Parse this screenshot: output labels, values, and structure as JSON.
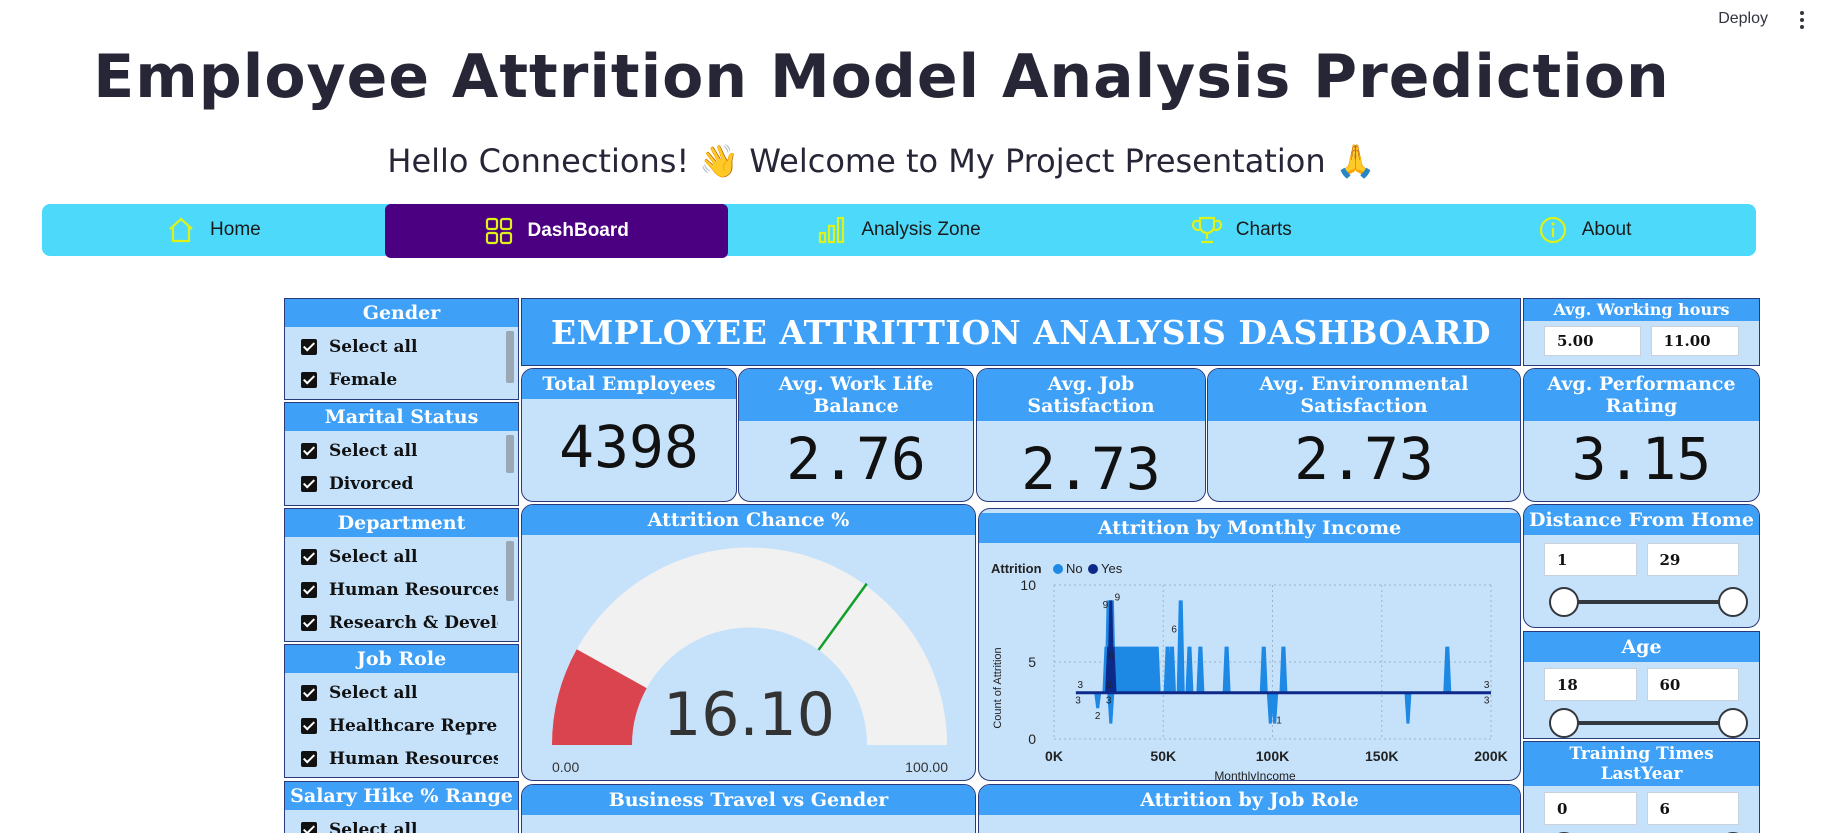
{
  "header": {
    "deploy_label": "Deploy"
  },
  "title": "Employee Attrition Model Analysis Prediction",
  "subtitle": "Hello Connections! 👋 Welcome to My Project Presentation 🙏",
  "nav": [
    {
      "label": "Home",
      "icon": "home-icon"
    },
    {
      "label": "DashBoard",
      "icon": "grid-icon"
    },
    {
      "label": "Analysis Zone",
      "icon": "bar-chart-icon"
    },
    {
      "label": "Charts",
      "icon": "trophy-icon"
    },
    {
      "label": "About",
      "icon": "info-icon"
    }
  ],
  "colors": {
    "nav_bg": "#4cd9fa",
    "nav_active": "#4b0082",
    "panel_head": "#3ea0f7",
    "panel_bg": "#c6e2fb",
    "gauge_fill": "#d9444f",
    "series_no": "#1e88e5",
    "series_yes": "#0d2a8a"
  },
  "dashboard": {
    "title": "EMPLOYEE ATTRITTION ANALYSIS DASHBOARD",
    "slicers": {
      "gender": {
        "title": "Gender",
        "items": [
          "Select all",
          "Female"
        ]
      },
      "marital": {
        "title": "Marital Status",
        "items": [
          "Select all",
          "Divorced"
        ]
      },
      "department": {
        "title": "Department",
        "items": [
          "Select all",
          "Human Resources",
          "Research & Develop..."
        ]
      },
      "jobrole": {
        "title": "Job Role",
        "items": [
          "Select all",
          "Healthcare Represen...",
          "Human Resources"
        ]
      },
      "salaryhike": {
        "title": "Salary Hike % Range",
        "items": [
          "Select all"
        ]
      }
    },
    "kpis": {
      "total_employees": {
        "label": "Total Employees",
        "value": "4398"
      },
      "work_life": {
        "label": "Avg. Work Life Balance",
        "value": "2.76"
      },
      "job_sat": {
        "label": "Avg. Job Satisfaction",
        "value": "2.73"
      },
      "env_sat": {
        "label": "Avg. Environmental Satisfaction",
        "value": "2.73"
      },
      "performance": {
        "label": "Avg. Performance Rating",
        "value": "3.15"
      }
    },
    "ranges": {
      "working_hours": {
        "title": "Avg. Working hours",
        "min": "5.00",
        "max": "11.00"
      },
      "distance": {
        "title": "Distance From Home",
        "min": "1",
        "max": "29",
        "low_frac": 0,
        "high_frac": 1
      },
      "age": {
        "title": "Age",
        "min": "18",
        "max": "60",
        "low_frac": 0,
        "high_frac": 1
      },
      "training": {
        "title": "Training Times LastYear",
        "min": "0",
        "max": "6",
        "low_frac": 0,
        "high_frac": 1
      }
    },
    "gauge": {
      "title": "Attrition Chance %",
      "value": "16.10",
      "min_label": "0.00",
      "max_label": "100.00",
      "value_num": 16.1,
      "target_num": 70
    },
    "bottom_panels": {
      "travel": "Business Travel vs Gender",
      "jobrole": "Attrition by Job Role"
    }
  },
  "chart_data": {
    "type": "area",
    "title": "Attrition by Monthly Income",
    "legend_title": "Attrition",
    "series": [
      {
        "name": "No"
      },
      {
        "name": "Yes"
      }
    ],
    "xlabel": "MonthlyIncome",
    "ylabel": "Count of Attrition",
    "x_ticks": [
      "0K",
      "50K",
      "100K",
      "150K",
      "200K"
    ],
    "y_ticks": [
      "0",
      "5",
      "10"
    ],
    "xlim": [
      0,
      200000
    ],
    "ylim": [
      0,
      10
    ],
    "baseline": 3,
    "no_peaks": [
      [
        24000,
        6
      ],
      [
        25000,
        9
      ],
      [
        26500,
        9
      ],
      [
        27500,
        6
      ],
      [
        29000,
        6
      ],
      [
        30500,
        6
      ],
      [
        32000,
        6
      ],
      [
        33500,
        6
      ],
      [
        35000,
        6
      ],
      [
        36500,
        6
      ],
      [
        38000,
        6
      ],
      [
        39500,
        6
      ],
      [
        41000,
        6
      ],
      [
        42500,
        6
      ],
      [
        44000,
        6
      ],
      [
        45500,
        6
      ],
      [
        47000,
        6
      ],
      [
        52000,
        6
      ],
      [
        54000,
        6
      ],
      [
        58000,
        9
      ],
      [
        62000,
        6
      ],
      [
        67000,
        6
      ],
      [
        79000,
        6
      ],
      [
        96000,
        6
      ],
      [
        105000,
        6
      ],
      [
        180000,
        6
      ]
    ],
    "yes_peaks": [
      [
        25000,
        6
      ],
      [
        26000,
        9
      ],
      [
        27000,
        6
      ]
    ],
    "dips": [
      [
        20000,
        2
      ],
      [
        26000,
        1
      ],
      [
        99000,
        1
      ],
      [
        101000,
        1
      ],
      [
        162000,
        1
      ]
    ],
    "data_labels": [
      {
        "x": 12000,
        "y": 3.3,
        "text": "3"
      },
      {
        "x": 11000,
        "y": 2.3,
        "text": "3"
      },
      {
        "x": 20000,
        "y": 1.3,
        "text": "2"
      },
      {
        "x": 25000,
        "y": 3.3,
        "text": "3"
      },
      {
        "x": 25000,
        "y": 2.3,
        "text": "3"
      },
      {
        "x": 29000,
        "y": 9.0,
        "text": "9"
      },
      {
        "x": 23500,
        "y": 8.5,
        "text": "9"
      },
      {
        "x": 55000,
        "y": 6.9,
        "text": "6"
      },
      {
        "x": 26000,
        "y": 5.2,
        "text": "6"
      },
      {
        "x": 103000,
        "y": 1.0,
        "text": "1"
      },
      {
        "x": 198000,
        "y": 3.3,
        "text": "3"
      },
      {
        "x": 198000,
        "y": 2.3,
        "text": "3"
      }
    ]
  }
}
